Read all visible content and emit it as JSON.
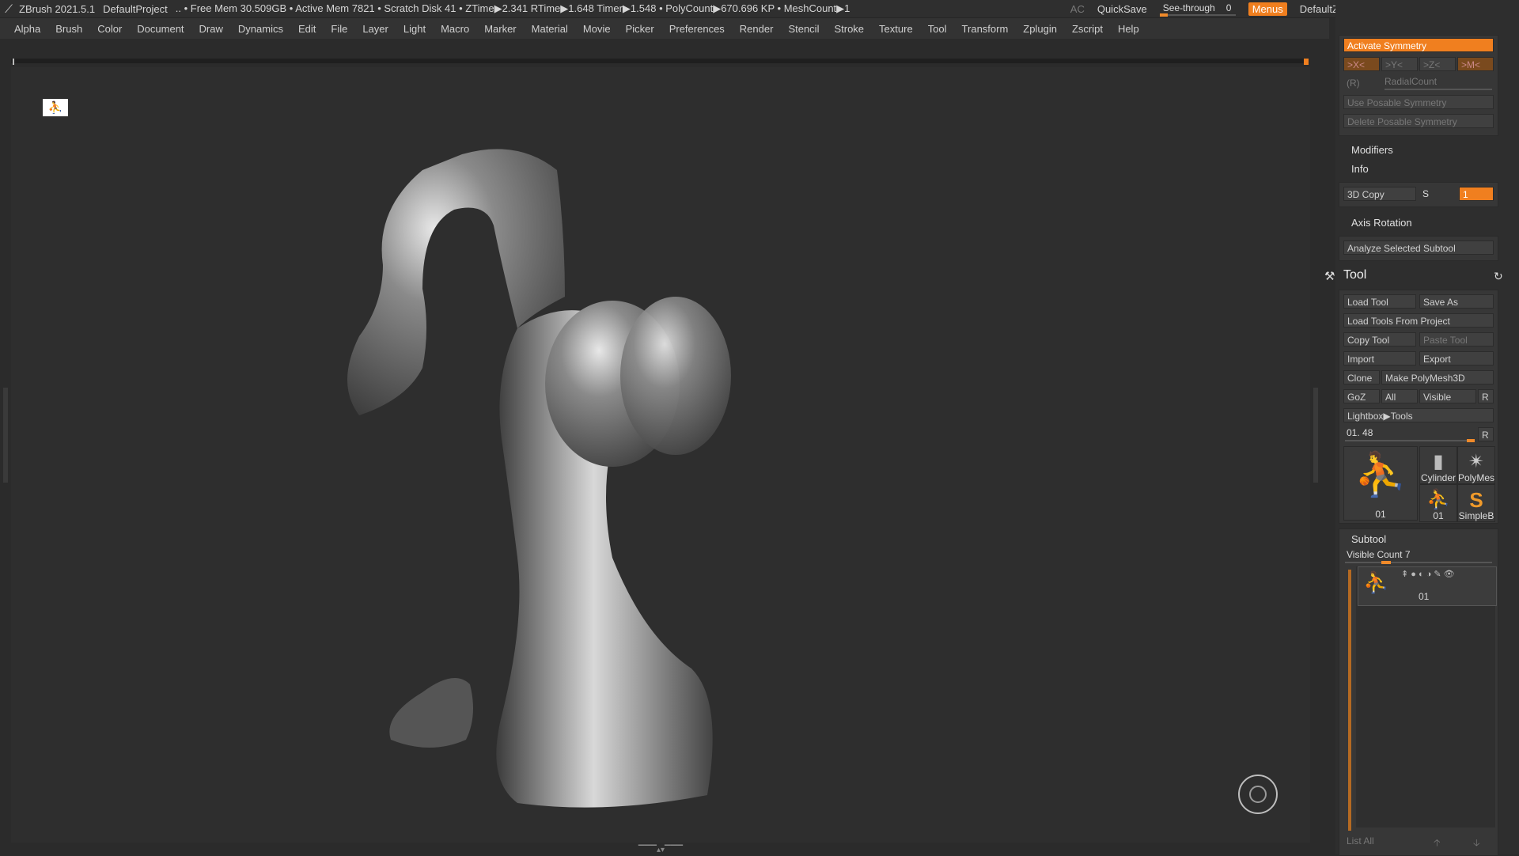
{
  "titlebar": {
    "app": "ZBrush 2021.5.1",
    "project": "DefaultProject",
    "stats": ".. • Free Mem 30.509GB • Active Mem 7821 • Scratch Disk 41 • ZTime▶2.341 RTime▶1.648 Timer▶1.548 • PolyCount▶670.696 KP • MeshCount▶1",
    "ac": "AC",
    "quicksave": "QuickSave",
    "seethrough_label": "See-through",
    "seethrough_value": "0",
    "menus": "Menus",
    "script": "DefaultZScript"
  },
  "menubar": [
    "Alpha",
    "Brush",
    "Color",
    "Document",
    "Draw",
    "Dynamics",
    "Edit",
    "File",
    "Layer",
    "Light",
    "Macro",
    "Marker",
    "Material",
    "Movie",
    "Picker",
    "Preferences",
    "Render",
    "Stencil",
    "Stroke",
    "Texture",
    "Tool",
    "Transform",
    "Zplugin",
    "Zscript",
    "Help"
  ],
  "symmetry": {
    "activate": "Activate Symmetry",
    "x": ">X<",
    "y": ">Y<",
    "z": ">Z<",
    "m": ">M<",
    "r": "(R)",
    "radial": "RadialCount",
    "use_posable": "Use Posable Symmetry",
    "delete_posable": "Delete Posable Symmetry"
  },
  "sections": {
    "modifiers": "Modifiers",
    "info": "Info",
    "copy3d": "3D Copy",
    "s": "S",
    "field_value": "1",
    "axis_rotation": "Axis Rotation",
    "analyze": "Analyze Selected Subtool"
  },
  "tool": {
    "title": "Tool",
    "load_tool": "Load Tool",
    "save_as": "Save As",
    "load_from_project": "Load Tools From Project",
    "copy_tool": "Copy Tool",
    "paste_tool": "Paste Tool",
    "import": "Import",
    "export": "Export",
    "clone": "Clone",
    "make_polymesh": "Make PolyMesh3D",
    "goz": "GoZ",
    "all": "All",
    "visible": "Visible",
    "r": "R",
    "lightbox": "Lightbox▶Tools",
    "current": "01. 48",
    "current_r": "R",
    "thumbs": [
      {
        "label": "01",
        "icon": "figure-icon"
      },
      {
        "label": "Cylinder",
        "icon": "cylinder-icon"
      },
      {
        "label": "PolyMes",
        "icon": "star-icon"
      },
      {
        "label": "01",
        "icon": "figure-icon"
      },
      {
        "label": "SimpleB",
        "icon": "simpleb-icon"
      }
    ]
  },
  "subtool": {
    "title": "Subtool",
    "visible_count": "Visible Count 7",
    "item_label": "01",
    "list_all": "List All"
  }
}
